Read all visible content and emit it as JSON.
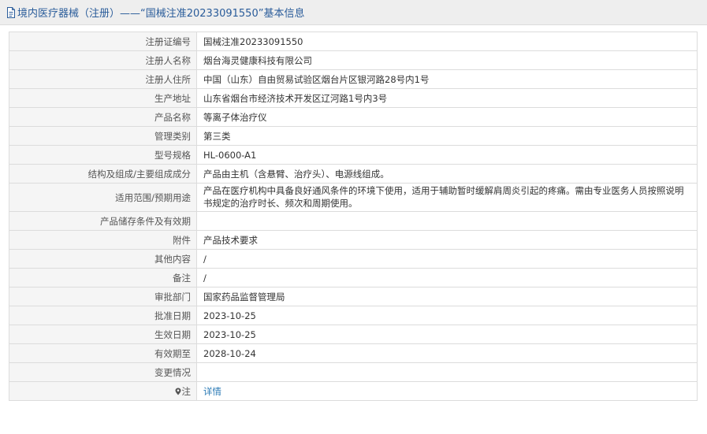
{
  "header": {
    "title": "境内医疗器械（注册）——“国械注准20233091550”基本信息"
  },
  "rows": [
    {
      "label": "注册证编号",
      "value": "国械注准20233091550"
    },
    {
      "label": "注册人名称",
      "value": "烟台海灵健康科技有限公司"
    },
    {
      "label": "注册人住所",
      "value": "中国（山东）自由贸易试验区烟台片区银河路28号内1号"
    },
    {
      "label": "生产地址",
      "value": "山东省烟台市经济技术开发区辽河路1号内3号"
    },
    {
      "label": "产品名称",
      "value": "等离子体治疗仪"
    },
    {
      "label": "管理类别",
      "value": "第三类"
    },
    {
      "label": "型号规格",
      "value": "HL-0600-A1"
    },
    {
      "label": "结构及组成/主要组成成分",
      "value": "产品由主机（含悬臂、治疗头）、电源线组成。"
    },
    {
      "label": "适用范围/预期用途",
      "value": "产品在医疗机构中具备良好通风条件的环境下使用，适用于辅助暂时缓解肩周炎引起的疼痛。需由专业医务人员按照说明书规定的治疗时长、频次和周期使用。"
    },
    {
      "label": "产品储存条件及有效期",
      "value": ""
    },
    {
      "label": "附件",
      "value": "产品技术要求"
    },
    {
      "label": "其他内容",
      "value": "/"
    },
    {
      "label": "备注",
      "value": "/"
    },
    {
      "label": "审批部门",
      "value": "国家药品监督管理局"
    },
    {
      "label": "批准日期",
      "value": "2023-10-25"
    },
    {
      "label": "生效日期",
      "value": "2023-10-25"
    },
    {
      "label": "有效期至",
      "value": "2028-10-24"
    },
    {
      "label": "变更情况",
      "value": ""
    }
  ],
  "note": {
    "label": "注",
    "link_text": "详情",
    "icon": "map-pin-icon"
  },
  "colors": {
    "title": "#2a5c9a",
    "link": "#2a7ab5",
    "border": "#dcdcdc",
    "header_bg": "#eeeeee"
  }
}
